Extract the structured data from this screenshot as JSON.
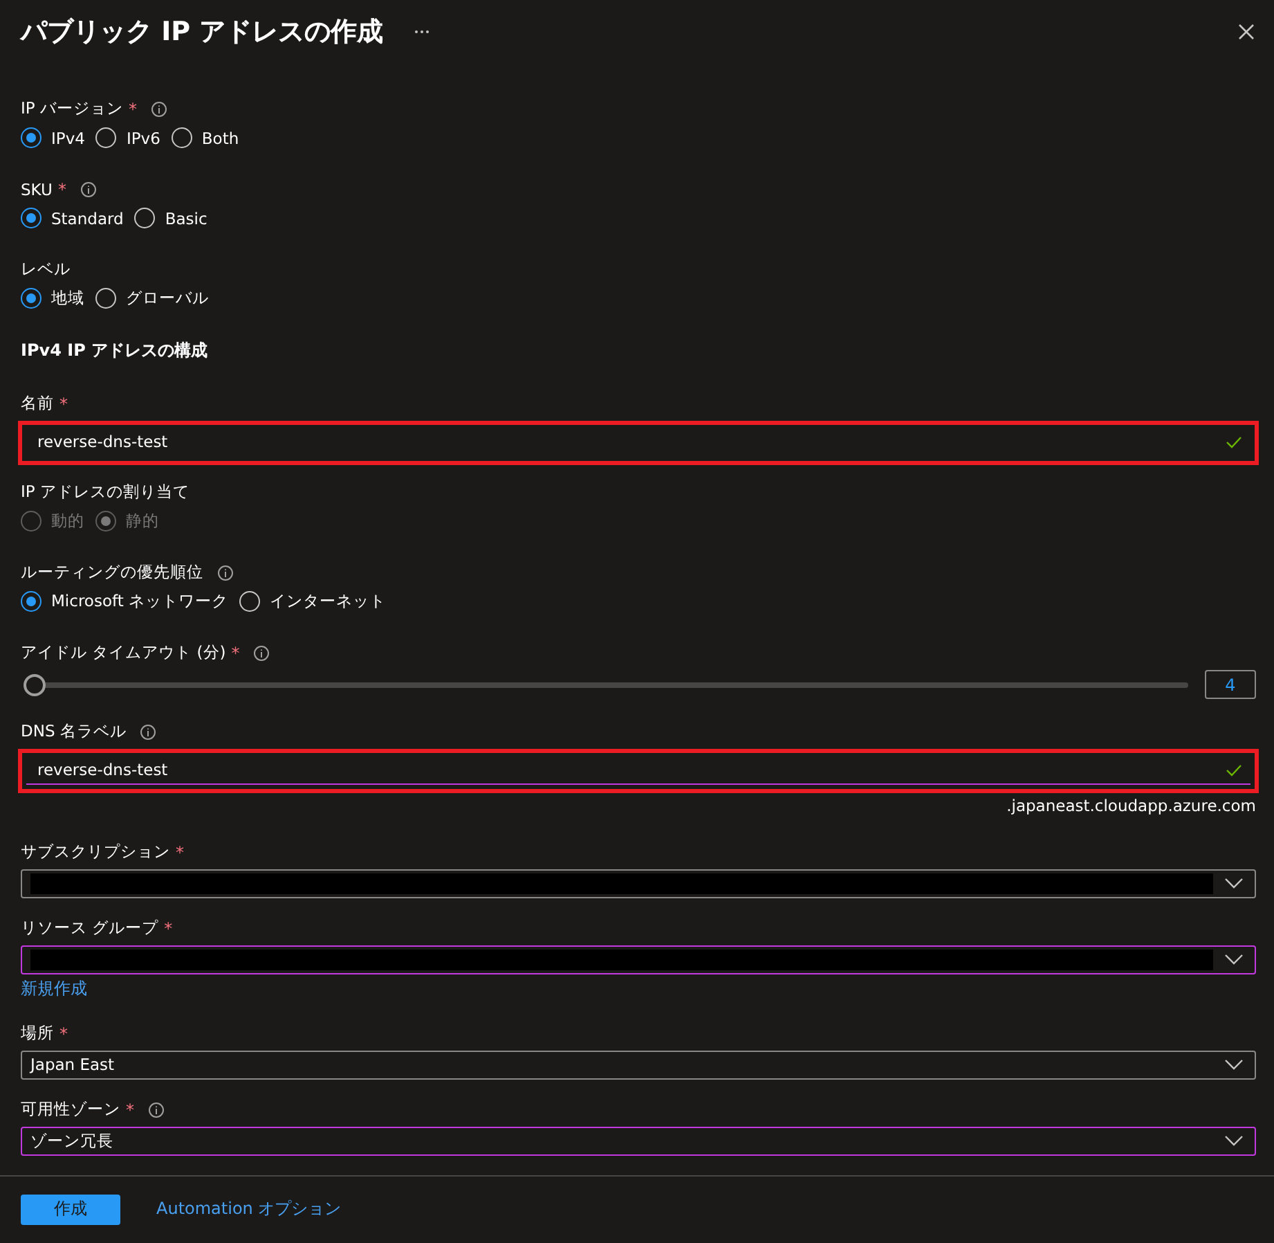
{
  "title": "パブリック IP アドレスの作成",
  "required_mark": "*",
  "fields": [
    {
      "kind": "radio",
      "label": "IP バージョン",
      "required": true,
      "info": true,
      "disabled": false,
      "options": [
        {
          "label": "IPv4",
          "selected": true
        },
        {
          "label": "IPv6",
          "selected": false
        },
        {
          "label": "Both",
          "selected": false
        }
      ]
    },
    {
      "kind": "radio",
      "label": "SKU",
      "required": true,
      "info": true,
      "disabled": false,
      "options": [
        {
          "label": "Standard",
          "selected": true
        },
        {
          "label": "Basic",
          "selected": false
        }
      ]
    },
    {
      "kind": "radio",
      "label": "レベル",
      "disabled": false,
      "options": [
        {
          "label": "地域",
          "selected": true
        },
        {
          "label": "グローバル",
          "selected": false
        }
      ]
    },
    {
      "kind": "heading",
      "label": "IPv4 IP アドレスの構成"
    },
    {
      "kind": "text",
      "label": "名前",
      "required": true,
      "value": "reverse-dns-test",
      "valid": true,
      "highlighted": true,
      "focused": false
    },
    {
      "kind": "radio",
      "label": "IP アドレスの割り当て",
      "disabled": true,
      "options": [
        {
          "label": "動的",
          "selected": false
        },
        {
          "label": "静的",
          "selected": true
        }
      ]
    },
    {
      "kind": "radio",
      "label": "ルーティングの優先順位",
      "info": true,
      "disabled": false,
      "options": [
        {
          "label": "Microsoft ネットワーク",
          "selected": true
        },
        {
          "label": "インターネット",
          "selected": false
        }
      ]
    },
    {
      "kind": "slider",
      "label": "アイドル タイムアウト (分)",
      "required": true,
      "info": true,
      "level": 0,
      "value": "4"
    },
    {
      "kind": "text",
      "label": "DNS 名ラベル",
      "info": true,
      "value": "reverse-dns-test",
      "valid": true,
      "highlighted": true,
      "focused": true,
      "suffix": ".japaneast.cloudapp.azure.com"
    },
    {
      "kind": "select",
      "label": "サブスクリプション",
      "required": true,
      "redacted": true,
      "focused": false
    },
    {
      "kind": "select",
      "label": "リソース グループ",
      "required": true,
      "redacted": true,
      "focused": true,
      "link": "新規作成"
    },
    {
      "kind": "select",
      "label": "場所",
      "required": true,
      "value": "Japan East",
      "focused": false
    },
    {
      "kind": "select",
      "label": "可用性ゾーン",
      "required": true,
      "info": true,
      "value": "ゾーン冗長",
      "focused": true
    }
  ],
  "footer": {
    "primary": "作成",
    "link": "Automation オプション"
  }
}
